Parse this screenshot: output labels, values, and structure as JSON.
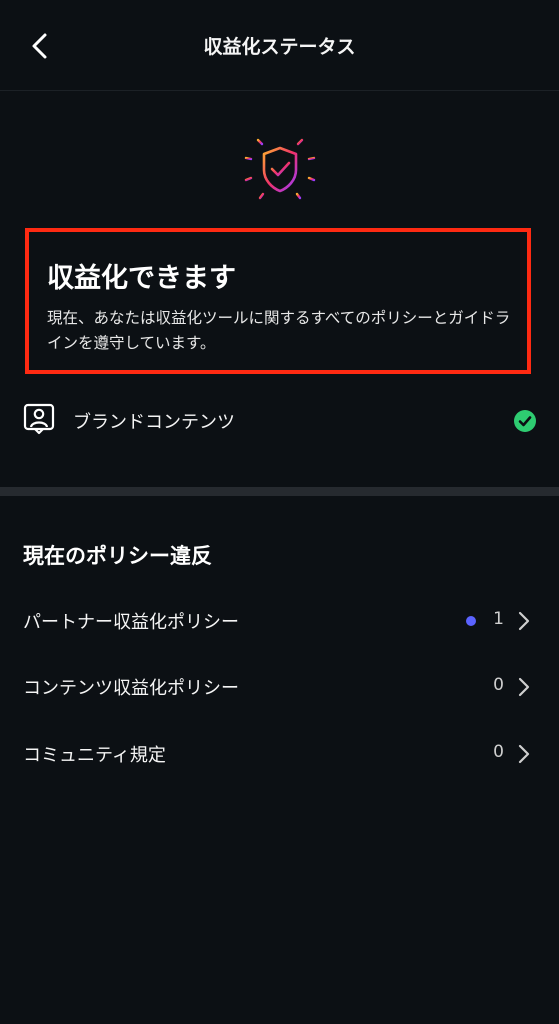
{
  "header": {
    "title": "収益化ステータス"
  },
  "status": {
    "title": "収益化できます",
    "description": "現在、あなたは収益化ツールに関するすべてのポリシーとガイドラインを遵守しています。",
    "highlight_color": "#ff2a12"
  },
  "brand_content": {
    "label": "ブランドコンテンツ",
    "status": "check-icon",
    "status_color": "#2ecc71"
  },
  "violations": {
    "title": "現在のポリシー違反",
    "items": [
      {
        "label": "パートナー収益化ポリシー",
        "count": "1",
        "has_dot": true
      },
      {
        "label": "コンテンツ収益化ポリシー",
        "count": "0",
        "has_dot": false
      },
      {
        "label": "コミュニティ規定",
        "count": "0",
        "has_dot": false
      }
    ]
  },
  "colors": {
    "background": "#0c1014",
    "dot": "#5b63ff"
  }
}
